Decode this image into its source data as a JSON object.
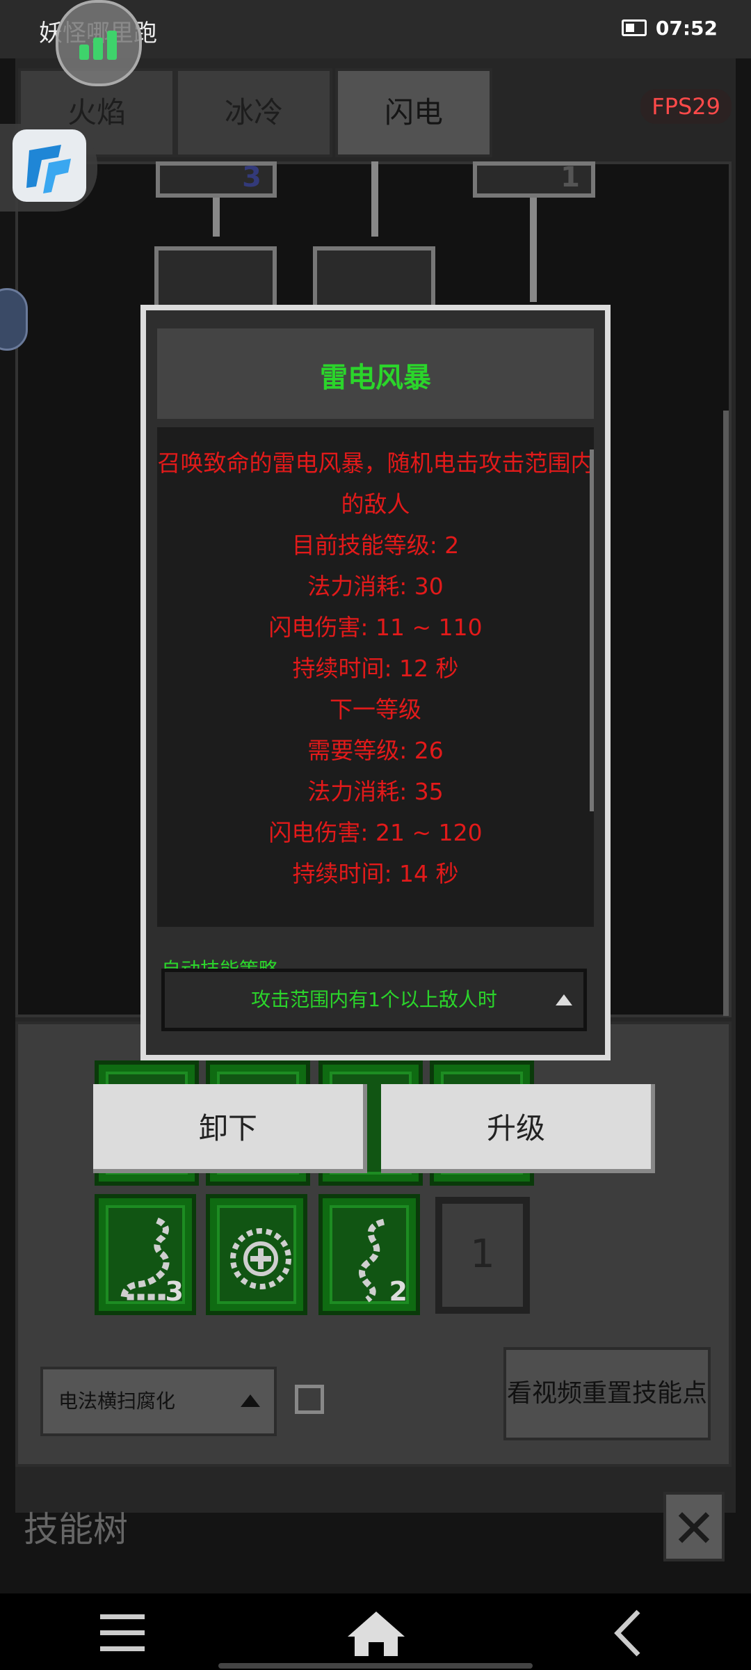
{
  "status_bar": {
    "app_name": "妖怪哪里跑",
    "time": "07:52"
  },
  "tabs": [
    {
      "label": "火焰",
      "active": false
    },
    {
      "label": "冰冷",
      "active": false
    },
    {
      "label": "闪电",
      "active": true
    }
  ],
  "fps": "FPS29",
  "tree_counts": [
    "3",
    "1"
  ],
  "modal": {
    "title": "雷电风暴",
    "description_lines": [
      "召唤致命的雷电风暴，随机电击攻击范围内",
      "的敌人",
      "",
      "目前技能等级: 2",
      "法力消耗: 30",
      "闪电伤害: 11 ~ 110",
      "持续时间: 12 秒",
      "",
      "下一等级",
      "需要等级: 26",
      "法力消耗: 35",
      "闪电伤害: 21 ~ 120",
      "持续时间: 14 秒"
    ],
    "auto_strategy_label": "自动技能策略",
    "auto_strategy_value": "攻击范围内有1个以上敌人时"
  },
  "actions": {
    "unequip": "卸下",
    "upgrade": "升级"
  },
  "equipped_slots": [
    {
      "icon": "dragon-icon",
      "level": "3"
    },
    {
      "icon": "rune-circle-icon",
      "level": ""
    },
    {
      "icon": "serpent-icon",
      "level": "2"
    }
  ],
  "empty_slot_points": "1",
  "strategy_select": "电法横扫腐化",
  "reset_button": "看视频重置技能点",
  "page_title": "技能树",
  "colors": {
    "accent_green": "#2bd52b",
    "text_red": "#e21a1a",
    "fps_red": "#ff4a4a",
    "slot_green": "#0f6b12"
  }
}
